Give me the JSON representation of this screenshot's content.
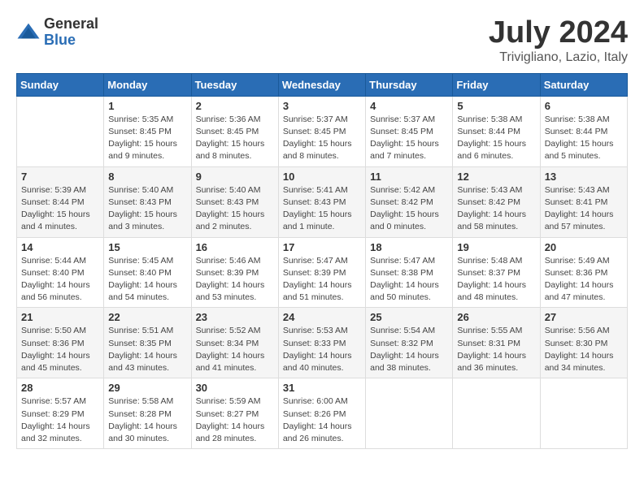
{
  "logo": {
    "general": "General",
    "blue": "Blue"
  },
  "title": "July 2024",
  "location": "Trivigliano, Lazio, Italy",
  "days_of_week": [
    "Sunday",
    "Monday",
    "Tuesday",
    "Wednesday",
    "Thursday",
    "Friday",
    "Saturday"
  ],
  "weeks": [
    [
      {
        "day": "",
        "info": ""
      },
      {
        "day": "1",
        "info": "Sunrise: 5:35 AM\nSunset: 8:45 PM\nDaylight: 15 hours\nand 9 minutes."
      },
      {
        "day": "2",
        "info": "Sunrise: 5:36 AM\nSunset: 8:45 PM\nDaylight: 15 hours\nand 8 minutes."
      },
      {
        "day": "3",
        "info": "Sunrise: 5:37 AM\nSunset: 8:45 PM\nDaylight: 15 hours\nand 8 minutes."
      },
      {
        "day": "4",
        "info": "Sunrise: 5:37 AM\nSunset: 8:45 PM\nDaylight: 15 hours\nand 7 minutes."
      },
      {
        "day": "5",
        "info": "Sunrise: 5:38 AM\nSunset: 8:44 PM\nDaylight: 15 hours\nand 6 minutes."
      },
      {
        "day": "6",
        "info": "Sunrise: 5:38 AM\nSunset: 8:44 PM\nDaylight: 15 hours\nand 5 minutes."
      }
    ],
    [
      {
        "day": "7",
        "info": "Sunrise: 5:39 AM\nSunset: 8:44 PM\nDaylight: 15 hours\nand 4 minutes."
      },
      {
        "day": "8",
        "info": "Sunrise: 5:40 AM\nSunset: 8:43 PM\nDaylight: 15 hours\nand 3 minutes."
      },
      {
        "day": "9",
        "info": "Sunrise: 5:40 AM\nSunset: 8:43 PM\nDaylight: 15 hours\nand 2 minutes."
      },
      {
        "day": "10",
        "info": "Sunrise: 5:41 AM\nSunset: 8:43 PM\nDaylight: 15 hours\nand 1 minute."
      },
      {
        "day": "11",
        "info": "Sunrise: 5:42 AM\nSunset: 8:42 PM\nDaylight: 15 hours\nand 0 minutes."
      },
      {
        "day": "12",
        "info": "Sunrise: 5:43 AM\nSunset: 8:42 PM\nDaylight: 14 hours\nand 58 minutes."
      },
      {
        "day": "13",
        "info": "Sunrise: 5:43 AM\nSunset: 8:41 PM\nDaylight: 14 hours\nand 57 minutes."
      }
    ],
    [
      {
        "day": "14",
        "info": "Sunrise: 5:44 AM\nSunset: 8:40 PM\nDaylight: 14 hours\nand 56 minutes."
      },
      {
        "day": "15",
        "info": "Sunrise: 5:45 AM\nSunset: 8:40 PM\nDaylight: 14 hours\nand 54 minutes."
      },
      {
        "day": "16",
        "info": "Sunrise: 5:46 AM\nSunset: 8:39 PM\nDaylight: 14 hours\nand 53 minutes."
      },
      {
        "day": "17",
        "info": "Sunrise: 5:47 AM\nSunset: 8:39 PM\nDaylight: 14 hours\nand 51 minutes."
      },
      {
        "day": "18",
        "info": "Sunrise: 5:47 AM\nSunset: 8:38 PM\nDaylight: 14 hours\nand 50 minutes."
      },
      {
        "day": "19",
        "info": "Sunrise: 5:48 AM\nSunset: 8:37 PM\nDaylight: 14 hours\nand 48 minutes."
      },
      {
        "day": "20",
        "info": "Sunrise: 5:49 AM\nSunset: 8:36 PM\nDaylight: 14 hours\nand 47 minutes."
      }
    ],
    [
      {
        "day": "21",
        "info": "Sunrise: 5:50 AM\nSunset: 8:36 PM\nDaylight: 14 hours\nand 45 minutes."
      },
      {
        "day": "22",
        "info": "Sunrise: 5:51 AM\nSunset: 8:35 PM\nDaylight: 14 hours\nand 43 minutes."
      },
      {
        "day": "23",
        "info": "Sunrise: 5:52 AM\nSunset: 8:34 PM\nDaylight: 14 hours\nand 41 minutes."
      },
      {
        "day": "24",
        "info": "Sunrise: 5:53 AM\nSunset: 8:33 PM\nDaylight: 14 hours\nand 40 minutes."
      },
      {
        "day": "25",
        "info": "Sunrise: 5:54 AM\nSunset: 8:32 PM\nDaylight: 14 hours\nand 38 minutes."
      },
      {
        "day": "26",
        "info": "Sunrise: 5:55 AM\nSunset: 8:31 PM\nDaylight: 14 hours\nand 36 minutes."
      },
      {
        "day": "27",
        "info": "Sunrise: 5:56 AM\nSunset: 8:30 PM\nDaylight: 14 hours\nand 34 minutes."
      }
    ],
    [
      {
        "day": "28",
        "info": "Sunrise: 5:57 AM\nSunset: 8:29 PM\nDaylight: 14 hours\nand 32 minutes."
      },
      {
        "day": "29",
        "info": "Sunrise: 5:58 AM\nSunset: 8:28 PM\nDaylight: 14 hours\nand 30 minutes."
      },
      {
        "day": "30",
        "info": "Sunrise: 5:59 AM\nSunset: 8:27 PM\nDaylight: 14 hours\nand 28 minutes."
      },
      {
        "day": "31",
        "info": "Sunrise: 6:00 AM\nSunset: 8:26 PM\nDaylight: 14 hours\nand 26 minutes."
      },
      {
        "day": "",
        "info": ""
      },
      {
        "day": "",
        "info": ""
      },
      {
        "day": "",
        "info": ""
      }
    ]
  ]
}
